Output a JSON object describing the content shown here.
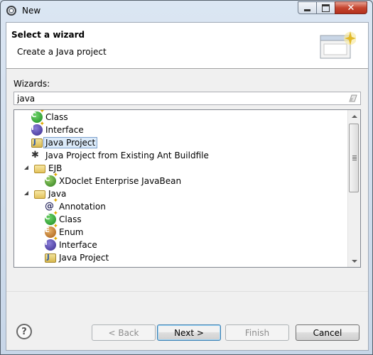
{
  "window": {
    "title": "New"
  },
  "header": {
    "title": "Select a wizard",
    "description": "Create a Java project"
  },
  "wizards_label": "Wizards:",
  "search": {
    "value": "java"
  },
  "tree": {
    "items": [
      {
        "label": "Class",
        "icon": "class-icon"
      },
      {
        "label": "Interface",
        "icon": "interface-icon"
      },
      {
        "label": "Java Project",
        "icon": "java-project-icon",
        "selected": true
      },
      {
        "label": "Java Project from Existing Ant Buildfile",
        "icon": "ant-icon"
      },
      {
        "label": "EJB",
        "icon": "folder-icon",
        "expanded": true
      },
      {
        "label": "XDoclet Enterprise JavaBean",
        "icon": "bean-icon"
      },
      {
        "label": "Java",
        "icon": "folder-icon",
        "expanded": true
      },
      {
        "label": "Annotation",
        "icon": "annotation-icon"
      },
      {
        "label": "Class",
        "icon": "class-icon"
      },
      {
        "label": "Enum",
        "icon": "enum-icon"
      },
      {
        "label": "Interface",
        "icon": "interface-icon"
      },
      {
        "label": "Java Project",
        "icon": "java-project-icon"
      }
    ]
  },
  "buttons": {
    "back": "< Back",
    "next": "Next >",
    "finish": "Finish",
    "cancel": "Cancel"
  }
}
